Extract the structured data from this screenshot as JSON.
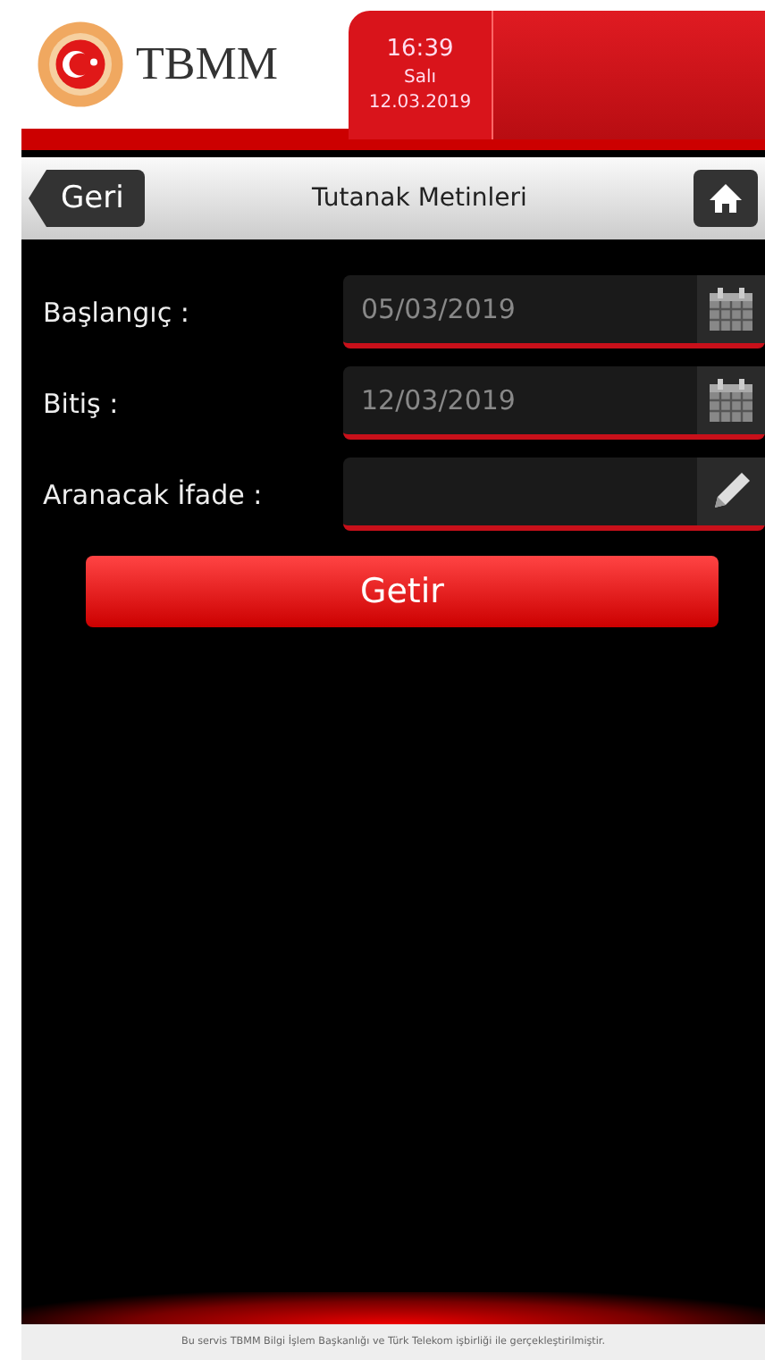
{
  "header": {
    "logo_text": "TBMM",
    "time": "16:39",
    "day": "Salı",
    "date": "12.03.2019"
  },
  "nav": {
    "back": "Geri",
    "title": "Tutanak Metinleri"
  },
  "fields": [
    {
      "label": "Başlangıç :",
      "value": "05/03/2019",
      "kind": "date"
    },
    {
      "label": "Bitiş :",
      "value": "12/03/2019",
      "kind": "date"
    },
    {
      "label": "Aranacak İfade :",
      "kind": "text"
    }
  ],
  "submit": "Getir",
  "footer": "Bu servis TBMM Bilgi İşlem Başkanlığı ve Türk Telekom işbirliği ile gerçekleştirilmiştir."
}
